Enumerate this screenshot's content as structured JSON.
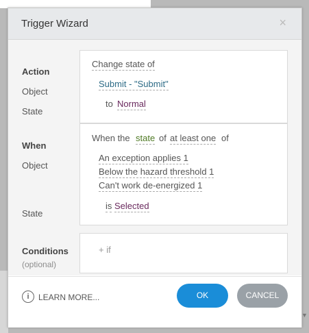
{
  "dialog": {
    "title": "Trigger Wizard",
    "close_glyph": "×"
  },
  "action": {
    "section_label": "Action",
    "object_label": "Object",
    "state_label": "State",
    "action_value": "Change state of",
    "object_value": "Submit - \"Submit\"",
    "state_prefix": "to",
    "state_value": "Normal"
  },
  "when": {
    "section_label": "When",
    "object_label": "Object",
    "state_label": "State",
    "condition_prefix": "When the",
    "condition_property": "state",
    "condition_of": "of",
    "condition_quantifier": "at least one",
    "condition_suffix": "of",
    "objects": [
      "An exception applies 1",
      "Below the hazard threshold 1",
      "Can't work de-energized 1"
    ],
    "state_prefix": "is",
    "state_value": "Selected"
  },
  "conditions": {
    "section_label": "Conditions",
    "optional_label": "(optional)",
    "add_label": "+ if"
  },
  "footer": {
    "info_glyph": "i",
    "learn_more": "LEARN MORE...",
    "ok_label": "OK",
    "cancel_label": "CANCEL"
  },
  "scroll_glyph": "▼",
  "colors": {
    "ok": "#1a8dd8",
    "cancel": "#9aa1a7",
    "object_link": "#2d6b86",
    "state_value": "#6a2a5e",
    "property": "#4f7a24"
  }
}
